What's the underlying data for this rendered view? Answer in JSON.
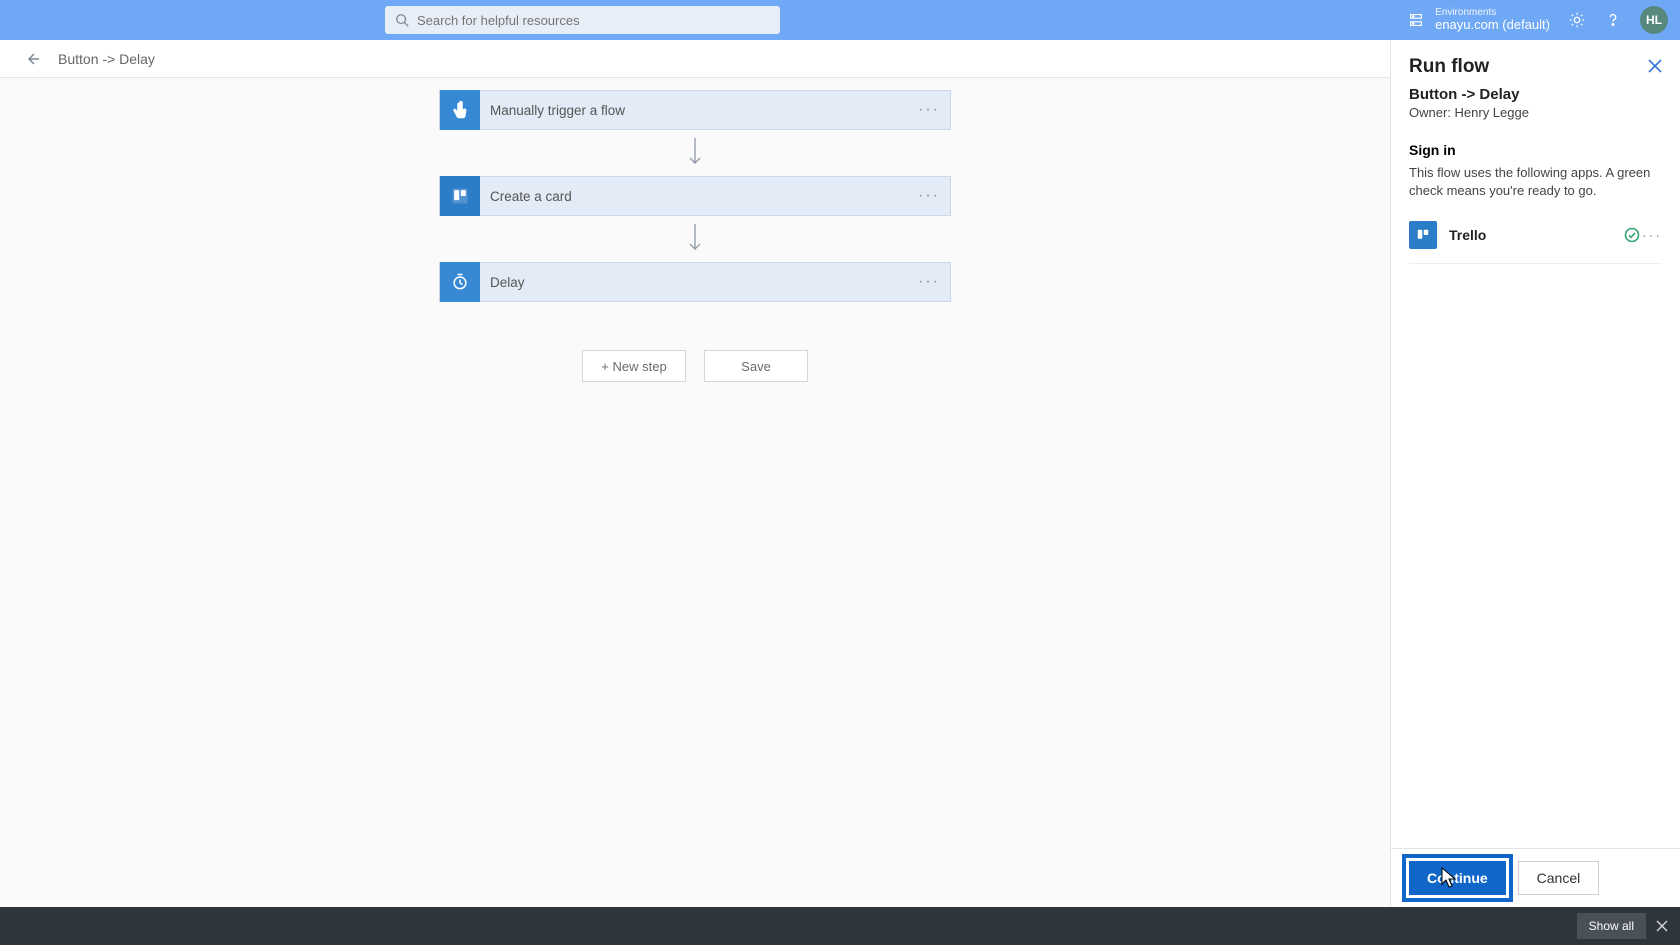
{
  "header": {
    "search_placeholder": "Search for helpful resources",
    "env_label": "Environments",
    "env_name": "enayu.com (default)",
    "avatar_initials": "HL"
  },
  "breadcrumb": {
    "title": "Button -> Delay"
  },
  "flow": {
    "steps": [
      {
        "label": "Manually trigger a flow",
        "icon": "touch"
      },
      {
        "label": "Create a card",
        "icon": "trello"
      },
      {
        "label": "Delay",
        "icon": "timer"
      }
    ],
    "new_step_label": "+ New step",
    "save_label": "Save"
  },
  "panel": {
    "title": "Run flow",
    "flow_name": "Button -> Delay",
    "owner": "Owner: Henry Legge",
    "signin_heading": "Sign in",
    "signin_desc": "This flow uses the following apps. A green check means you're ready to go.",
    "connections": [
      {
        "name": "Trello",
        "status": "ok"
      }
    ],
    "continue_label": "Continue",
    "cancel_label": "Cancel"
  },
  "bottom": {
    "showall_label": "Show all"
  }
}
